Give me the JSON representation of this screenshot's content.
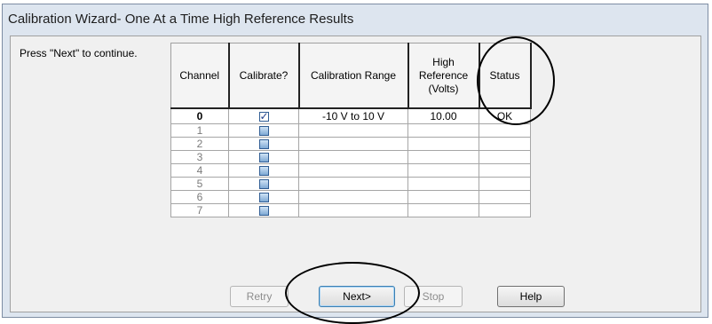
{
  "window": {
    "title": "Calibration Wizard- One At a Time High Reference Results"
  },
  "prompt": "Press \"Next\" to continue.",
  "table": {
    "headers": [
      "Channel",
      "Calibrate?",
      "Calibration Range",
      "High Reference (Volts)",
      "Status"
    ],
    "rows": [
      {
        "channel": "0",
        "calibrate": true,
        "range": "-10 V to 10 V",
        "high_ref": "10.00",
        "status": "OK"
      },
      {
        "channel": "1",
        "calibrate": false,
        "range": "",
        "high_ref": "",
        "status": ""
      },
      {
        "channel": "2",
        "calibrate": false,
        "range": "",
        "high_ref": "",
        "status": ""
      },
      {
        "channel": "3",
        "calibrate": false,
        "range": "",
        "high_ref": "",
        "status": ""
      },
      {
        "channel": "4",
        "calibrate": false,
        "range": "",
        "high_ref": "",
        "status": ""
      },
      {
        "channel": "5",
        "calibrate": false,
        "range": "",
        "high_ref": "",
        "status": ""
      },
      {
        "channel": "6",
        "calibrate": false,
        "range": "",
        "high_ref": "",
        "status": ""
      },
      {
        "channel": "7",
        "calibrate": false,
        "range": "",
        "high_ref": "",
        "status": ""
      }
    ]
  },
  "buttons": {
    "retry": "Retry",
    "next": "Next>",
    "stop": "Stop",
    "help": "Help"
  },
  "colors": {
    "window_frame": "#dde5ef",
    "client_bg": "#f0f0f0",
    "checkbox_blue": "#7fa9d4"
  }
}
